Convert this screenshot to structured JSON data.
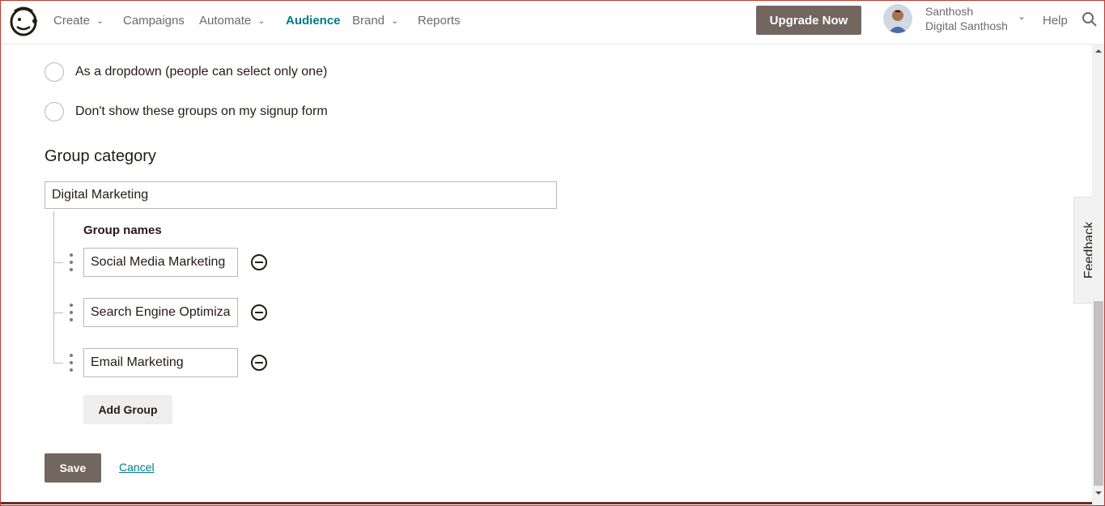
{
  "header": {
    "nav": [
      {
        "label": "Create",
        "has_chevron": true
      },
      {
        "label": "Campaigns",
        "has_chevron": false
      },
      {
        "label": "Automate",
        "has_chevron": true
      },
      {
        "label": "Audience",
        "has_chevron": false,
        "active": true
      },
      {
        "label": "Brand",
        "has_chevron": true
      },
      {
        "label": "Reports",
        "has_chevron": false
      }
    ],
    "upgrade_label": "Upgrade Now",
    "user_name": "Santhosh",
    "user_org": "Digital Santhosh",
    "help_label": "Help",
    "icons": {
      "logo": "mailchimp-logo-icon",
      "search": "search-icon",
      "avatar": "user-avatar"
    }
  },
  "form": {
    "options": [
      {
        "label": "As a dropdown (people can select only one)",
        "selected": false
      },
      {
        "label": "Don't show these groups on my signup form",
        "selected": false
      }
    ],
    "category_title": "Group category",
    "category_value": "Digital Marketing",
    "group_names_label": "Group names",
    "groups": [
      {
        "value": "Social Media Marketing"
      },
      {
        "value": "Search Engine Optimization"
      },
      {
        "value": "Email Marketing"
      }
    ],
    "add_group_label": "Add Group",
    "save_label": "Save",
    "cancel_label": "Cancel"
  },
  "feedback_label": "Feedback",
  "colors": {
    "accent": "#007c89",
    "button_dark": "#72665e",
    "button_light": "#eeeeee"
  }
}
